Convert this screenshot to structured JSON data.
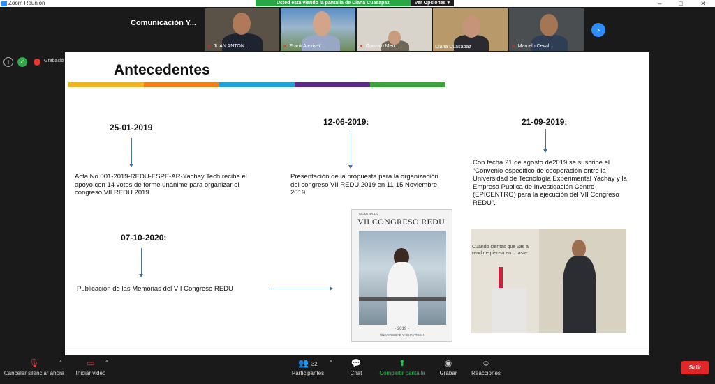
{
  "window": {
    "title": "Zoom Reunión"
  },
  "share_banner": {
    "message": "Usted está viendo la pantalla de Diana Cuasapaz",
    "options_label": "Ver Opciones ▾"
  },
  "meeting": {
    "title": "Comunicación Y..."
  },
  "participants": [
    {
      "name": "JUAN ANTON..."
    },
    {
      "name": "Frank Alexis-Y..."
    },
    {
      "name": "Gonzalo Men..."
    },
    {
      "name": "Diana Cuasapaz"
    },
    {
      "name": "Marcelo Ceval..."
    }
  ],
  "recording": {
    "label": "Grabació"
  },
  "slide": {
    "heading": "Antecedentes",
    "colors": [
      "#f0b323",
      "#ee7f1b",
      "#1ea2d9",
      "#5b2a86",
      "#3ca43c"
    ],
    "events": [
      {
        "date": "25-01-2019",
        "text": "Acta No.001-2019-REDU-ESPE-AR-Yachay Tech recibe el apoyo con 14 votos de forme unánime para organizar el congreso VII REDU  2019"
      },
      {
        "date": "12-06-2019:",
        "text": "Presentación de la propuesta para la organización del congreso VII REDU 2019 en 11-15 Noviembre 2019"
      },
      {
        "date": "21-09-2019:",
        "text": "Con fecha 21 de agosto de2019 se suscribe el “Convenio específico de cooperación entre la Universidad de Tecnología Experimental Yachay y la Empresa Pública de Investigación Centro (EPICENTRO) para la ejecución del VII Congreso REDU”."
      },
      {
        "date": "07-10-2020:",
        "text": "Publicación de las Memorias del VII Congreso REDU"
      }
    ],
    "book": {
      "small": "MEMORIAS",
      "title": "VII CONGRESO REDU",
      "year": "- 2019 -",
      "univ": "UNIVERSIDAD YACHAY TECH"
    },
    "photo_caption": "Cuando sientas que vas a rendirte piensa en ... aste"
  },
  "toolbar": {
    "mute": "Cancelar silenciar ahora",
    "video": "Iniciar video",
    "participants": "Participantes",
    "participants_count": "32",
    "chat": "Chat",
    "share": "Compartir pantalla",
    "record": "Grabar",
    "reactions": "Reacciones",
    "exit": "Salir"
  }
}
